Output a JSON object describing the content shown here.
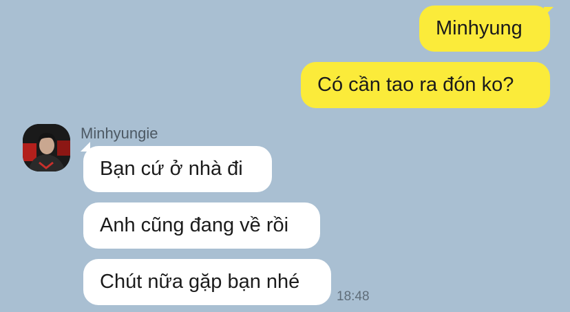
{
  "outgoing": [
    {
      "text": "Minhyung"
    },
    {
      "text": "Có cần tao ra đón ko?"
    }
  ],
  "incoming": {
    "sender_name": "Minhyungie",
    "avatar_icon": "profile-photo",
    "messages": [
      {
        "text": "Bạn cứ ở nhà đi"
      },
      {
        "text": "Anh cũng đang về rồi"
      },
      {
        "text": "Chút nữa gặp bạn nhé"
      }
    ],
    "time": "18:48"
  },
  "colors": {
    "background": "#a9bfd2",
    "outgoing_bubble": "#fbeb3a",
    "incoming_bubble": "#ffffff"
  }
}
